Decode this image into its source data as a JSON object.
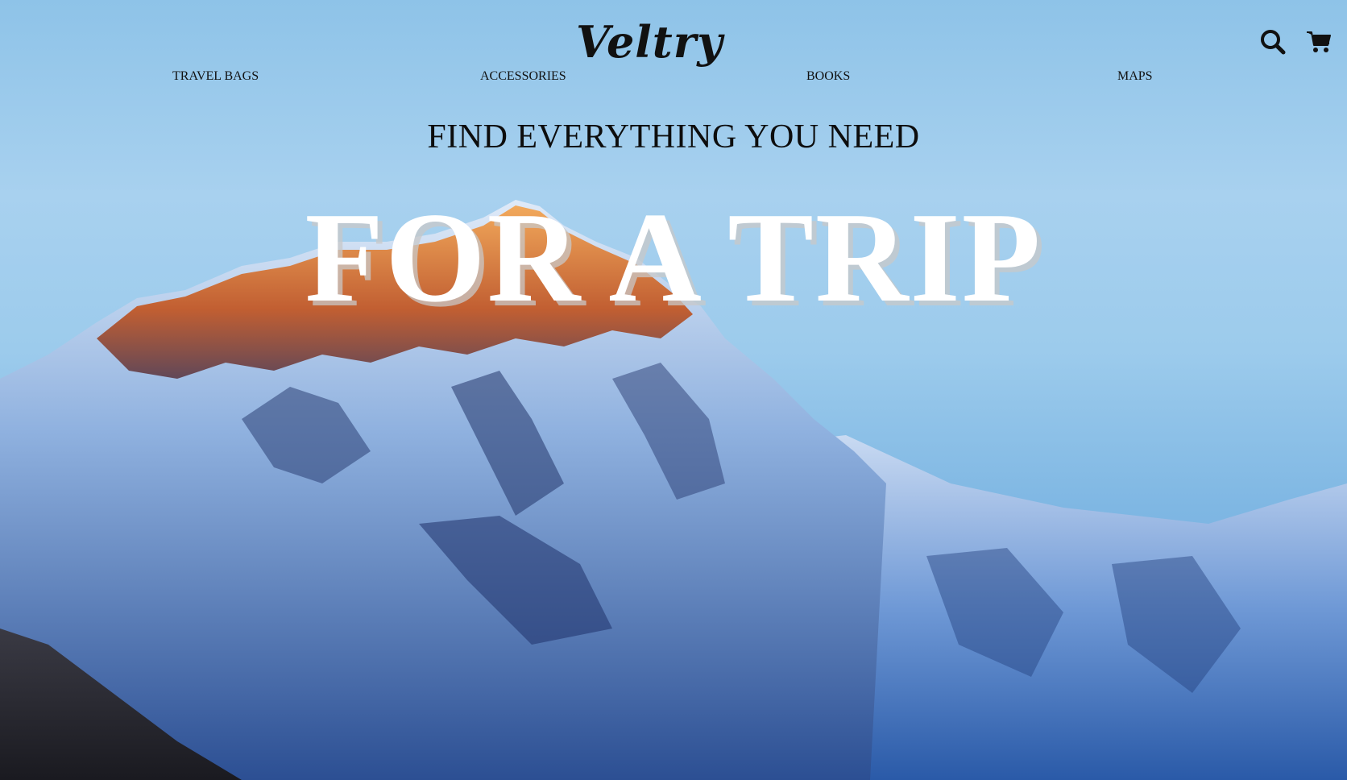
{
  "brand": {
    "logo_text": "Veltry"
  },
  "nav": {
    "items": [
      {
        "label": "TRAVEL BAGS"
      },
      {
        "label": "ACCESSORIES"
      },
      {
        "label": "BOOKS"
      },
      {
        "label": "MAPS"
      }
    ]
  },
  "header_icons": {
    "search": "search-icon",
    "cart": "cart-icon"
  },
  "hero": {
    "subheading": "FIND EVERYTHING YOU NEED",
    "headline": "FOR A TRIP",
    "background": "snow-capped mountain peak at sunrise under blue sky"
  },
  "colors": {
    "text_dark": "#111111",
    "headline_white": "#ffffff",
    "sky_blue": "#9ccbec",
    "summit_orange": "#e0781f",
    "snow_blue": "#3f6fb5"
  }
}
